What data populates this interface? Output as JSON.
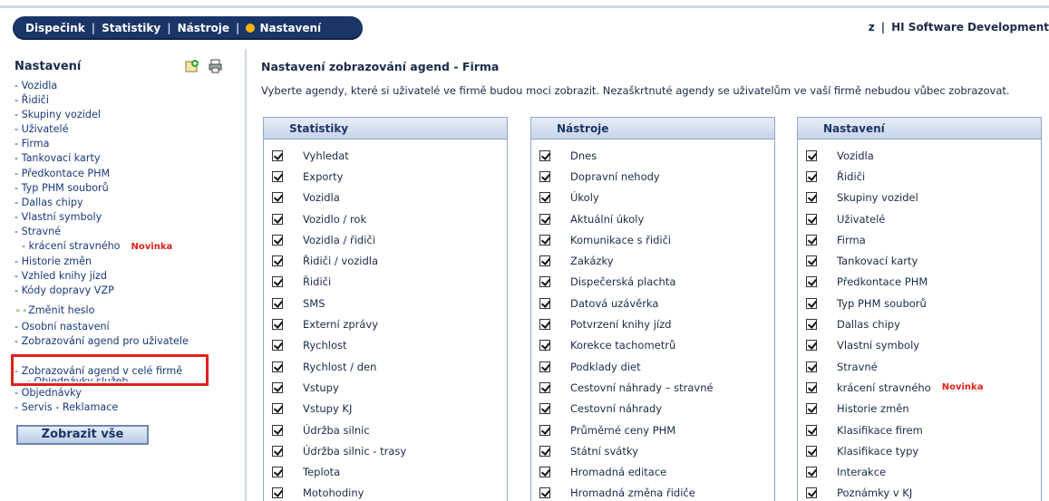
{
  "nav": {
    "items": [
      "Dispečink",
      "Statistiky",
      "Nástroje",
      "Nastavení"
    ],
    "separator": "|",
    "user": "z",
    "company": "HI Software Development"
  },
  "sidebar": {
    "title": "Nastavení",
    "icons": [
      "add-icon",
      "print-icon"
    ],
    "items": [
      "- Vozidla",
      "- Řidiči",
      "- Skupiny vozidel",
      "- Uživatelé",
      "- Firma",
      "- Tankovací karty",
      "- Předkontace PHM",
      "- Typ PHM souborů",
      "- Dallas chipy",
      "- Vlastní symboly",
      "- Stravné",
      "- krácení stravného",
      "- Historie změn",
      "- Vzhled knihy jízd",
      "- Kódy dopravy VZP",
      "Změnit heslo",
      "- Osobní nastavení",
      "- Zobrazování agend pro uživatele",
      "- Zobrazování agend v celé firmě",
      "- Objednávky služeb",
      "- Objednávky",
      "- Servis - Reklamace"
    ],
    "new_badge": "Novinka",
    "show_all": "Zobrazit vše"
  },
  "main": {
    "title": "Nastavení zobrazování agend - Firma",
    "description": "Vyberte agendy, které si uživatelé ve firmě budou moci zobrazit. Nezaškrtnuté agendy se uživatelům ve vaší firmě nebudou vůbec zobrazovat.",
    "columns": [
      {
        "header": "Statistiky",
        "items": [
          "Vyhledat",
          "Exporty",
          "Vozidla",
          "Vozidlo / rok",
          "Vozidla / řidiči",
          "Řidiči / vozidla",
          "Řidiči",
          "SMS",
          "Externí zprávy",
          "Rychlost",
          "Rychlost / den",
          "Vstupy",
          "Vstupy KJ",
          "Údržba silnic",
          "Údržba silnic - trasy",
          "Teplota",
          "Motohodiny"
        ]
      },
      {
        "header": "Nástroje",
        "items": [
          "Dnes",
          "Dopravní nehody",
          "Úkoly",
          "Aktuální úkoly",
          "Komunikace s řidiči",
          "Zakázky",
          "Dispečerská plachta",
          "Datová uzávěrka",
          "Potvrzení knihy jízd",
          "Korekce tachometrů",
          "Podklady diet",
          "Cestovní náhrady – stravné",
          "Cestovní náhrady",
          "Průměrné ceny PHM",
          "Státní svátky",
          "Hromadná editace",
          "Hromadná změna řidiče"
        ]
      },
      {
        "header": "Nastavení",
        "items": [
          "Vozidla",
          "Řidiči",
          "Skupiny vozidel",
          "Uživatelé",
          "Firma",
          "Tankovací karty",
          "Předkontace PHM",
          "Typ PHM souborů",
          "Dallas chipy",
          "Vlastní symboly",
          "Stravné",
          "krácení stravného",
          "Historie změn",
          "Klasifikace firem",
          "Klasifikace typy",
          "Interakce",
          "Poznámky v KJ"
        ]
      }
    ]
  }
}
